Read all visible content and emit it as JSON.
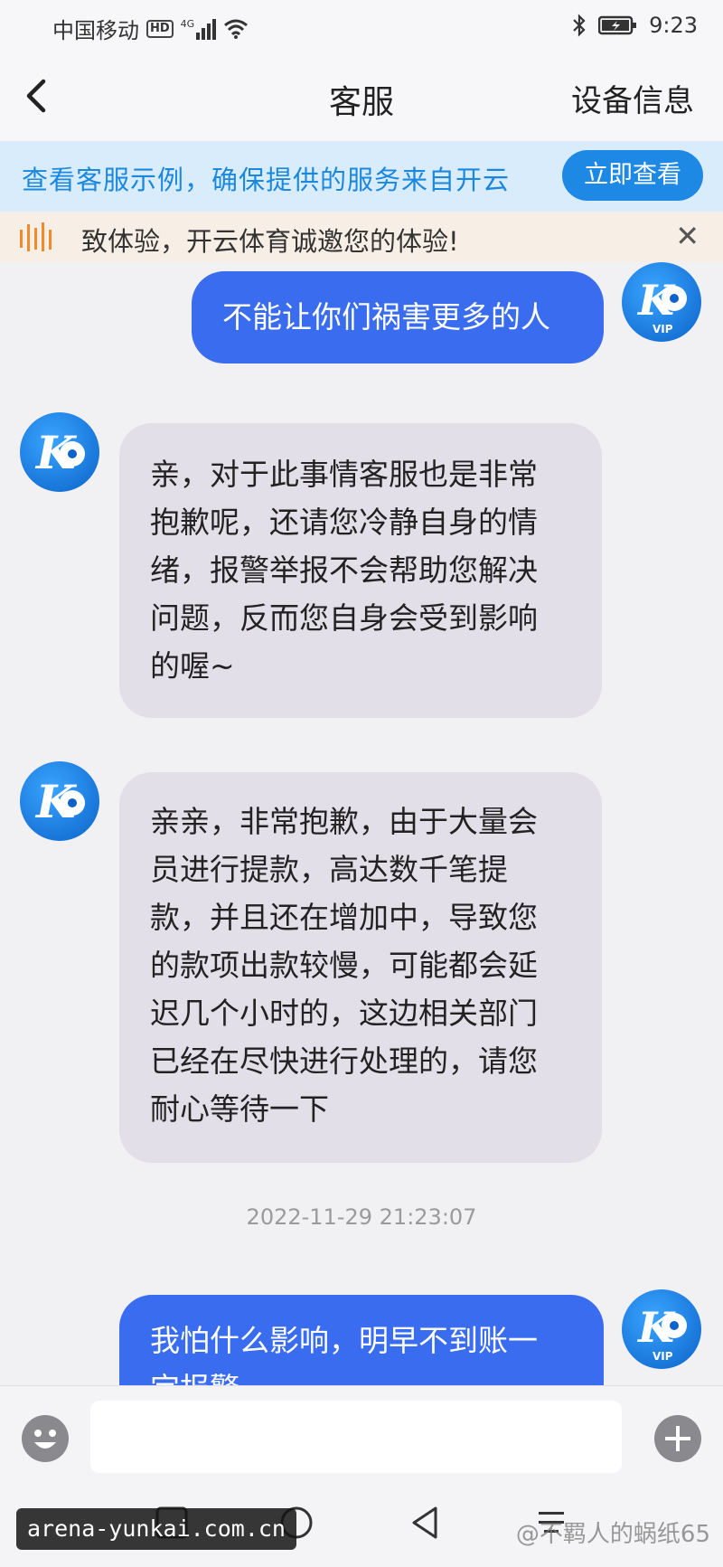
{
  "status_bar": {
    "carrier": "中国移动",
    "hd": "HD",
    "network": "4G",
    "time": "9:23"
  },
  "nav": {
    "title": "客服",
    "right_label": "设备信息"
  },
  "banner": {
    "text": "查看客服示例，确保提供的服务来自开云",
    "button_label": "立即查看"
  },
  "notice": {
    "text": "致体验，开云体育诚邀您的体验!"
  },
  "messages": [
    {
      "side": "out",
      "lines": [
        "不能让你们祸害更多的人"
      ]
    },
    {
      "side": "in",
      "lines": [
        "亲，对于此事情客服也是非常",
        "抱歉呢，还请您冷静自身的情",
        "绪，报警举报不会帮助您解决",
        "问题，反而您自身会受到影响",
        "的喔~"
      ]
    },
    {
      "side": "in",
      "lines": [
        "亲亲，非常抱歉，由于大量会",
        "员进行提款，高达数千笔提",
        "款，并且还在增加中，导致您",
        "的款项出款较慢，可能都会延",
        "迟几个小时的，这边相关部门",
        "已经在尽快进行处理的，请您",
        "耐心等待一下"
      ]
    },
    {
      "side": "out",
      "lines": [
        "我怕什么影响，明早不到账一",
        "定报警"
      ]
    }
  ],
  "timestamp": "2022-11-29 21:23:07",
  "avatar": {
    "logo": "K",
    "badge": "VIP"
  },
  "input": {
    "placeholder": ""
  },
  "watermark": {
    "left": "arena-yunkai.com.cn",
    "right": "@不羁人的蜗纸65"
  },
  "colors": {
    "accent": "#1e88e5",
    "bubble_out": "#3a6cf0",
    "bubble_in": "#e3dfe8"
  }
}
